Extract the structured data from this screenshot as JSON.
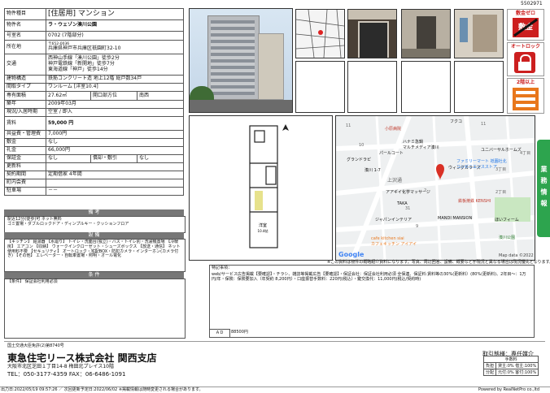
{
  "doc_id": "5502971",
  "spec": {
    "type_label": "物件種目",
    "type_value": "[住居用] マンション",
    "name_label": "物件名",
    "name_value": "ラ・ウェゾン湊川公園",
    "room_label": "号室名",
    "room_value": "0702 (7階部分)",
    "address_label": "所在地",
    "zip": "〒652-0036",
    "address_value": "兵庫県神戸市兵庫区祇園町32-10",
    "transit_label": "交通",
    "transit_lines": [
      "西神山手線「湊川公園」徒歩2分",
      "神戸電鉄線「新開地」徒歩7分",
      "東海道線「神戸」徒歩14分"
    ],
    "structure_label": "建物構造",
    "structure_value": "鉄筋コンクリート造 地上12階 総戸数34戸",
    "layout_label": "間取タイプ",
    "layout_value": "ワンルーム [洋室10.4]",
    "area_label": "専有面積",
    "area_value": "27.62㎡",
    "orient_label": "開口部方位",
    "orient_value": "南西",
    "built_label": "築年",
    "built_value": "2009年03月",
    "status_label": "現況/入居時期",
    "status_value": "空室 / 即入",
    "rent_label": "賃料",
    "rent_value": "59,000 円",
    "fee_label": "共益費・管理費",
    "fee_value": "7,000円",
    "deposit_label": "敷金",
    "deposit_value": "なし",
    "key_label": "礼金",
    "key_value": "66,000円",
    "hosho_label": "保証金",
    "hosho_value": "なし",
    "shikibiki_label": "償却・敷引",
    "shikibiki_value": "なし",
    "renew_label": "更新料",
    "renew_value": "",
    "contract_label": "契約期間",
    "contract_value": "定期借家 4年間",
    "town_label": "町内会費",
    "town_value": "",
    "parking_label": "駐車場",
    "parking_value": "－－"
  },
  "biko": {
    "head": "備 考",
    "text": "駅近12分(徒歩)可   ネット無料\nゴミ置場・ダブルロックドア・ディンプルキー・クッションフロア"
  },
  "setsubi": {
    "head": "設 備",
    "text": "【キッチン】 給湯器 【水廻り】 トイレ・洗面台(独立)・バス・トイレ別・洗濯機置場 【冷暖房】 エアコン 【収納】 ウォークインクローゼット・シューズボックス 【放送・通信】 ネット使用料不要 【セキュリティ】 オートロック・宅配BOX・防犯カメラ・インターホン(カメラ付き) 【その他】 エレベーター・自転車置場・照明・オール電化"
  },
  "joken": {
    "head": "条 件",
    "text": "【条件】 保証会社利用必須"
  },
  "icons": {
    "zero_label": "敷金ゼロ",
    "zero_mark": "敷金",
    "autolock_label": "オートロック",
    "floor_label": "2階以上"
  },
  "side_tab": "業務情報",
  "map": {
    "labels": [
      "小原病院",
      "ハナミ急鍋",
      "マルチメディア湊川",
      "パールコート",
      "グランドラピ",
      "湊川 1-7",
      "上沢通",
      "アアギイ化学マッサージ",
      "ウィングカラーズ",
      "ファミリーマート 祇園社北",
      "コンビニエンスストア",
      "鉄板焼鉄 KENSHI",
      "ジャパンインテリア",
      "TAKA",
      "MANDI MANSION",
      "cafe kitchen siai",
      "カフェキッチン アイアイ",
      "ほいフィーム",
      "ユニバーサルホームズ",
      "湊川公園",
      "フクコ",
      "2丁目",
      "3丁目",
      "4丁目",
      "11",
      "10",
      "9",
      "31",
      "2",
      "11"
    ],
    "google": "Google",
    "mapdata": "Map data ©2022",
    "note": "※この資料は物件の概略紹介資料になります。写真、周辺回答、設備、概要などが現況と異なる場合は現況優先となります。"
  },
  "remarks": {
    "label": "特記事項：",
    "text": "web/サービス広告掲載【要確認】・チラシ、雑誌等掲載広告【要確認】・保証会社：保証会社利用必須 全保連、保証料:賃料等の30%(更新料）(80%(更新料)、2年目～：1万円/年・保険：保険要加入（年契約 8,200円）・口座振替手数料：220円(税込）・鍵交換代：11,000円(税込/契約時)",
    "ad_label": "ＡＤ",
    "ad_value": "88500円"
  },
  "footer": {
    "license": "国土交通大臣免許(2)第8740号",
    "company": "東急住宅リース株式会社 関西支店",
    "address": "大阪市北区芝田１丁目14-8 梅田北プレイス10階",
    "tel": "TEL：050-3177-4359 FAX：06-6486-1091",
    "torihiki": "取引態様：専任媒介",
    "tesuryo": "手数料",
    "futan_label": "負担",
    "futan_value": "貸主:0% 借主:100%",
    "haibun_label": "分配",
    "haibun_value": "元付:0% 客付:100%",
    "print_line": "出力日:2022/05/19 09:57:26 ／ 次回更新予定日:2022/06/02 ※掲載情報は随時変更される場合があります。",
    "powered": "Powered by RealNetPro co.,ltd"
  },
  "colors": {
    "header_gray": "#777777",
    "side_green": "#2da44e",
    "accent_red": "#cc1f1f",
    "accent_orange": "#e8771c"
  }
}
